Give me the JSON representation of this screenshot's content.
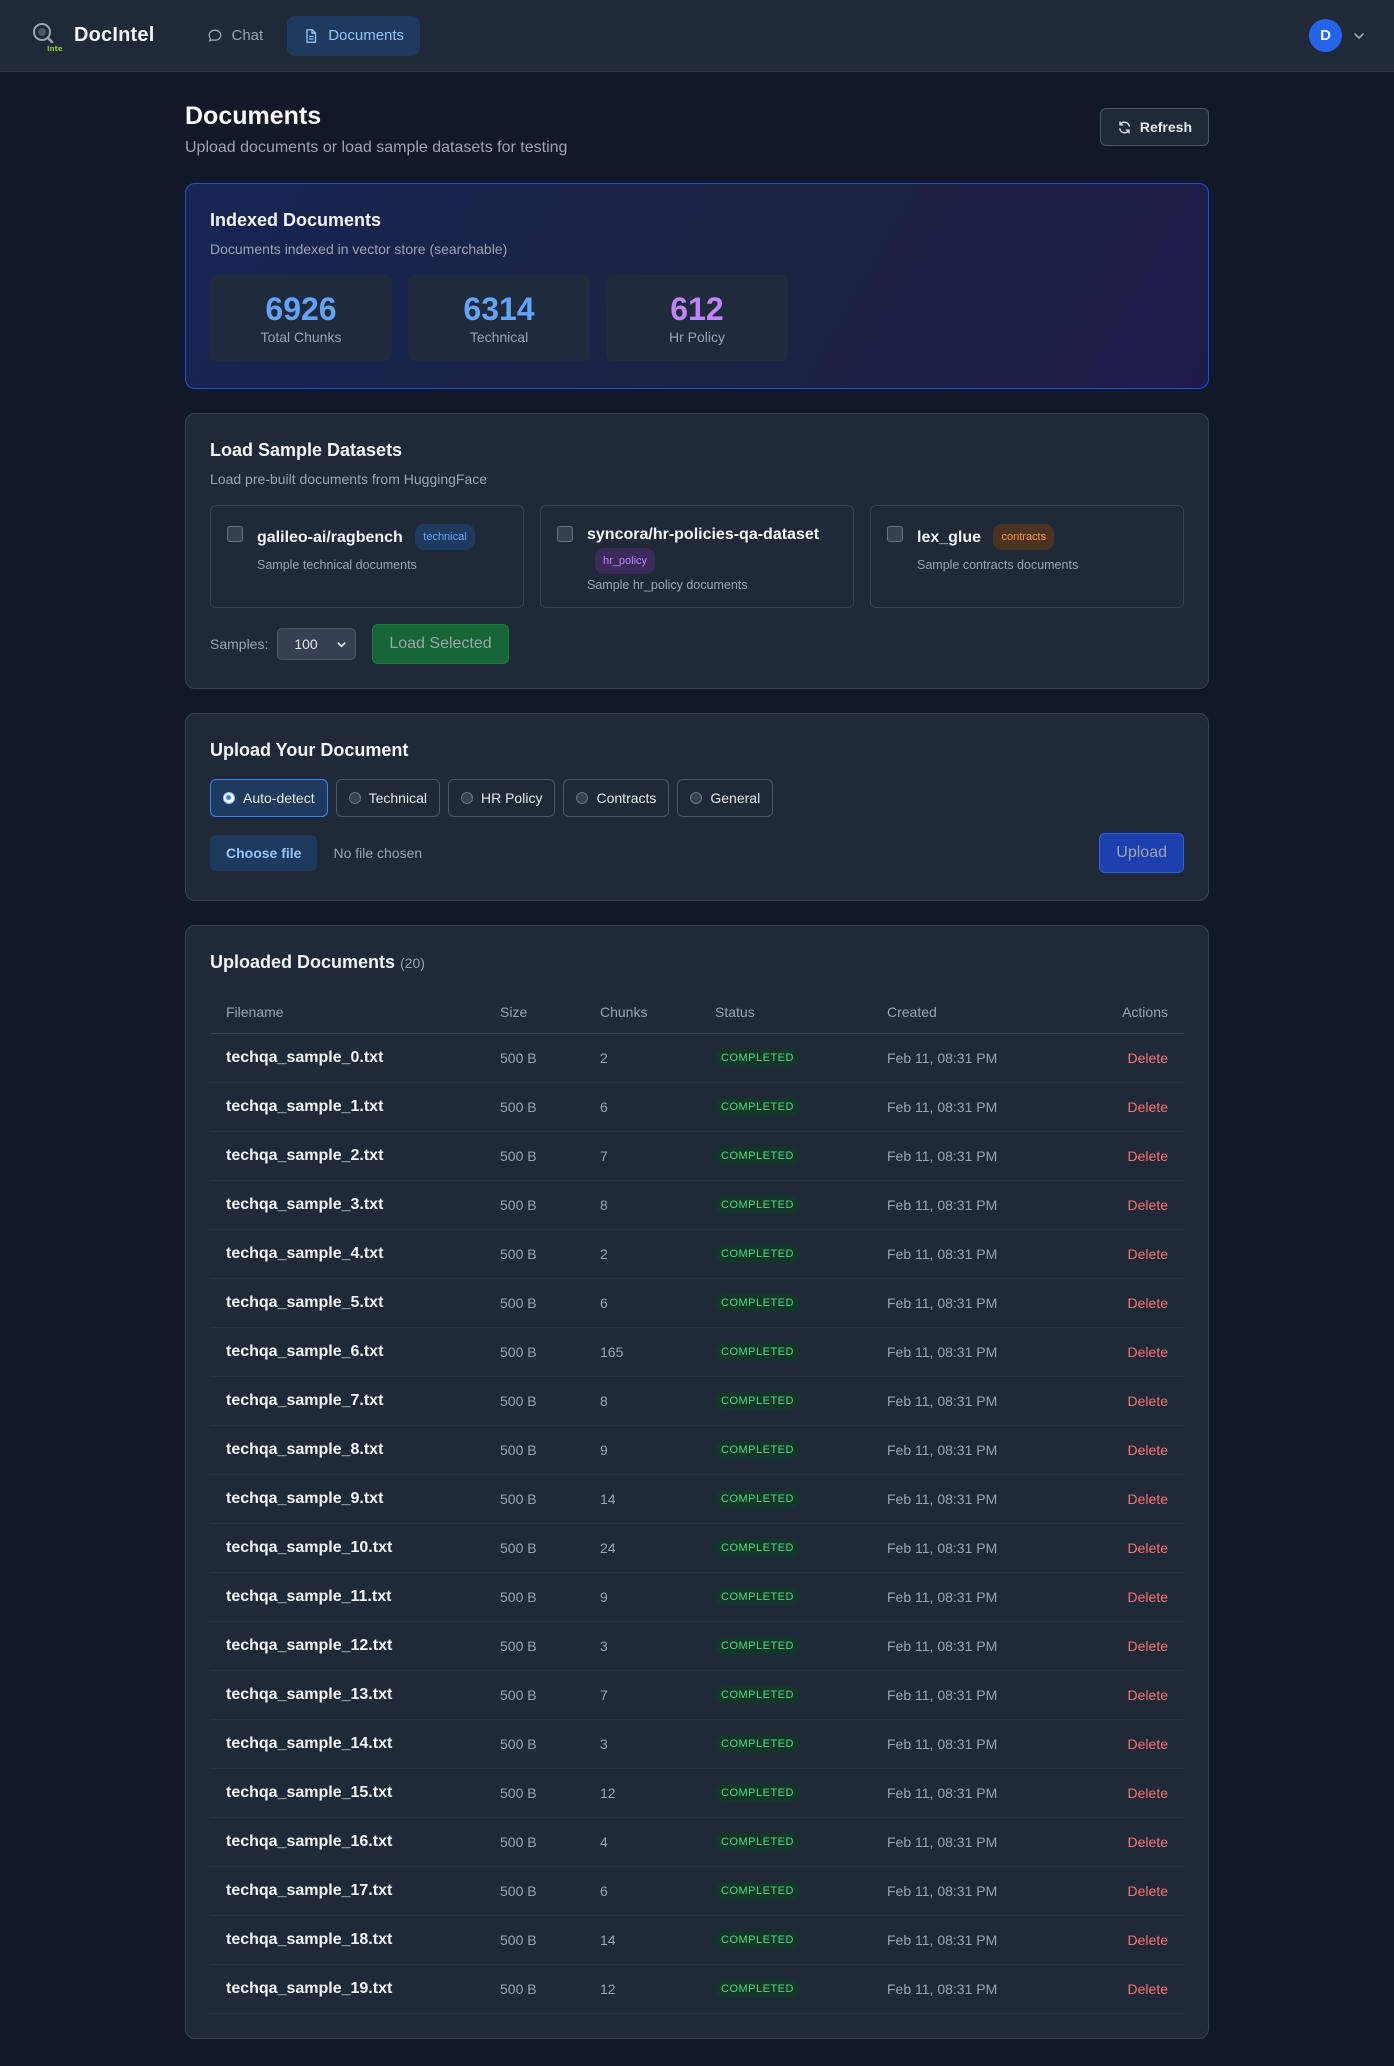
{
  "header": {
    "brand": "DocIntel",
    "logo_caption": "Intel",
    "nav": [
      {
        "label": "Chat",
        "icon": "chat-bubble-icon",
        "active": false
      },
      {
        "label": "Documents",
        "icon": "document-icon",
        "active": true
      }
    ],
    "user_initial": "D"
  },
  "page": {
    "title": "Documents",
    "subtitle": "Upload documents or load sample datasets for testing",
    "refresh_label": "Refresh"
  },
  "indexed": {
    "title": "Indexed Documents",
    "subtitle": "Documents indexed in vector store (searchable)",
    "stats": [
      {
        "value": "6926",
        "label": "Total Chunks",
        "color": "#60a5fa"
      },
      {
        "value": "6314",
        "label": "Technical",
        "color": "#60a5fa"
      },
      {
        "value": "612",
        "label": "Hr Policy",
        "color": "#c084fc"
      }
    ]
  },
  "samples": {
    "title": "Load Sample Datasets",
    "subtitle": "Load pre-built documents from HuggingFace",
    "datasets": [
      {
        "name": "galileo-ai/ragbench",
        "tag": "technical",
        "description": "Sample technical documents"
      },
      {
        "name": "syncora/hr-policies-qa-dataset",
        "tag": "hr_policy",
        "description": "Sample hr_policy documents"
      },
      {
        "name": "lex_glue",
        "tag": "contracts",
        "description": "Sample contracts documents"
      }
    ],
    "samples_label": "Samples:",
    "samples_value": "100",
    "load_label": "Load Selected"
  },
  "upload": {
    "title": "Upload Your Document",
    "types": [
      {
        "label": "Auto-detect",
        "selected": true
      },
      {
        "label": "Technical",
        "selected": false
      },
      {
        "label": "HR Policy",
        "selected": false
      },
      {
        "label": "Contracts",
        "selected": false
      },
      {
        "label": "General",
        "selected": false
      }
    ],
    "choose_label": "Choose file",
    "no_file": "No file chosen",
    "upload_label": "Upload"
  },
  "documents": {
    "title": "Uploaded Documents",
    "count": "(20)",
    "columns": [
      "Filename",
      "Size",
      "Chunks",
      "Status",
      "Created",
      "Actions"
    ],
    "rows": [
      {
        "filename": "techqa_sample_0.txt",
        "size": "500 B",
        "chunks": "2",
        "status": "COMPLETED",
        "created": "Feb 11, 08:31 PM",
        "action": "Delete"
      },
      {
        "filename": "techqa_sample_1.txt",
        "size": "500 B",
        "chunks": "6",
        "status": "COMPLETED",
        "created": "Feb 11, 08:31 PM",
        "action": "Delete"
      },
      {
        "filename": "techqa_sample_2.txt",
        "size": "500 B",
        "chunks": "7",
        "status": "COMPLETED",
        "created": "Feb 11, 08:31 PM",
        "action": "Delete"
      },
      {
        "filename": "techqa_sample_3.txt",
        "size": "500 B",
        "chunks": "8",
        "status": "COMPLETED",
        "created": "Feb 11, 08:31 PM",
        "action": "Delete"
      },
      {
        "filename": "techqa_sample_4.txt",
        "size": "500 B",
        "chunks": "2",
        "status": "COMPLETED",
        "created": "Feb 11, 08:31 PM",
        "action": "Delete"
      },
      {
        "filename": "techqa_sample_5.txt",
        "size": "500 B",
        "chunks": "6",
        "status": "COMPLETED",
        "created": "Feb 11, 08:31 PM",
        "action": "Delete"
      },
      {
        "filename": "techqa_sample_6.txt",
        "size": "500 B",
        "chunks": "165",
        "status": "COMPLETED",
        "created": "Feb 11, 08:31 PM",
        "action": "Delete"
      },
      {
        "filename": "techqa_sample_7.txt",
        "size": "500 B",
        "chunks": "8",
        "status": "COMPLETED",
        "created": "Feb 11, 08:31 PM",
        "action": "Delete"
      },
      {
        "filename": "techqa_sample_8.txt",
        "size": "500 B",
        "chunks": "9",
        "status": "COMPLETED",
        "created": "Feb 11, 08:31 PM",
        "action": "Delete"
      },
      {
        "filename": "techqa_sample_9.txt",
        "size": "500 B",
        "chunks": "14",
        "status": "COMPLETED",
        "created": "Feb 11, 08:31 PM",
        "action": "Delete"
      },
      {
        "filename": "techqa_sample_10.txt",
        "size": "500 B",
        "chunks": "24",
        "status": "COMPLETED",
        "created": "Feb 11, 08:31 PM",
        "action": "Delete"
      },
      {
        "filename": "techqa_sample_11.txt",
        "size": "500 B",
        "chunks": "9",
        "status": "COMPLETED",
        "created": "Feb 11, 08:31 PM",
        "action": "Delete"
      },
      {
        "filename": "techqa_sample_12.txt",
        "size": "500 B",
        "chunks": "3",
        "status": "COMPLETED",
        "created": "Feb 11, 08:31 PM",
        "action": "Delete"
      },
      {
        "filename": "techqa_sample_13.txt",
        "size": "500 B",
        "chunks": "7",
        "status": "COMPLETED",
        "created": "Feb 11, 08:31 PM",
        "action": "Delete"
      },
      {
        "filename": "techqa_sample_14.txt",
        "size": "500 B",
        "chunks": "3",
        "status": "COMPLETED",
        "created": "Feb 11, 08:31 PM",
        "action": "Delete"
      },
      {
        "filename": "techqa_sample_15.txt",
        "size": "500 B",
        "chunks": "12",
        "status": "COMPLETED",
        "created": "Feb 11, 08:31 PM",
        "action": "Delete"
      },
      {
        "filename": "techqa_sample_16.txt",
        "size": "500 B",
        "chunks": "4",
        "status": "COMPLETED",
        "created": "Feb 11, 08:31 PM",
        "action": "Delete"
      },
      {
        "filename": "techqa_sample_17.txt",
        "size": "500 B",
        "chunks": "6",
        "status": "COMPLETED",
        "created": "Feb 11, 08:31 PM",
        "action": "Delete"
      },
      {
        "filename": "techqa_sample_18.txt",
        "size": "500 B",
        "chunks": "14",
        "status": "COMPLETED",
        "created": "Feb 11, 08:31 PM",
        "action": "Delete"
      },
      {
        "filename": "techqa_sample_19.txt",
        "size": "500 B",
        "chunks": "12",
        "status": "COMPLETED",
        "created": "Feb 11, 08:31 PM",
        "action": "Delete"
      }
    ]
  }
}
